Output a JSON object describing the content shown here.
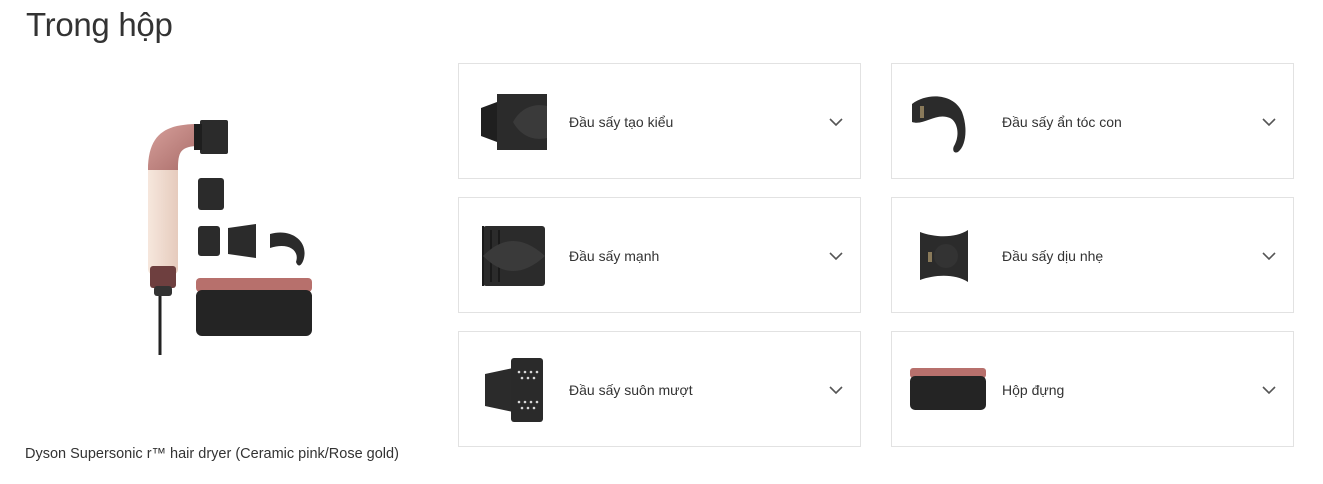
{
  "section": {
    "title": "Trong hộp",
    "product_caption": "Dyson Supersonic r™ hair dryer (Ceramic pink/Rose gold)"
  },
  "items": [
    {
      "label": "Đầu sấy tạo kiểu",
      "icon": "styling-concentrator-icon"
    },
    {
      "label": "Đầu sấy ẩn tóc con",
      "icon": "flyaway-attachment-icon"
    },
    {
      "label": "Đầu sấy mạnh",
      "icon": "wide-tooth-comb-icon"
    },
    {
      "label": "Đầu sấy dịu nhẹ",
      "icon": "gentle-air-attachment-icon"
    },
    {
      "label": "Đầu sấy suôn mượt",
      "icon": "smoothing-nozzle-icon"
    },
    {
      "label": "Hộp đựng",
      "icon": "storage-case-icon"
    }
  ],
  "colors": {
    "rose_gold": "#c48a86",
    "ceramic_pink": "#f1dfd3",
    "attachment_black": "#2b2b2b",
    "border": "#e2e2e2"
  }
}
